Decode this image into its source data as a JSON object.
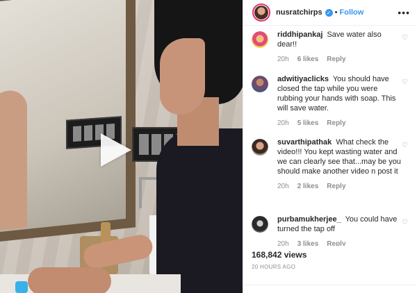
{
  "post": {
    "username": "nusratchirps",
    "follow_label": "Follow",
    "separator": "•",
    "more_icon": "more-options-icon",
    "verified_icon": "verified-badge-icon"
  },
  "video": {
    "play_icon": "play-icon"
  },
  "comments": [
    {
      "user": "riddhipankaj",
      "text": "Save water also dear!!",
      "time": "20h",
      "likes": "6 likes",
      "reply": "Reply"
    },
    {
      "user": "adwitiyaclicks",
      "text": "You should have closed the tap while you were rubbing your hands with soap. This will save water.",
      "time": "20h",
      "likes": "5 likes",
      "reply": "Reply"
    },
    {
      "user": "suvarthipathak",
      "text": "What check the video!!! You kept wasting water and we can clearly see that...may be you should make another video n post it",
      "time": "20h",
      "likes": "2 likes",
      "reply": "Reply"
    },
    {
      "user": "purbamukherjee_",
      "text": "You could have turned the tap off",
      "time": "20h",
      "likes": "3 likes",
      "reply": "Reply"
    }
  ],
  "stats": {
    "views": "168,842 views",
    "time_ago": "20 HOURS AGO"
  },
  "colors": {
    "accent": "#3897f0",
    "ring": "#e1306c",
    "muted": "#8e8e8e"
  }
}
